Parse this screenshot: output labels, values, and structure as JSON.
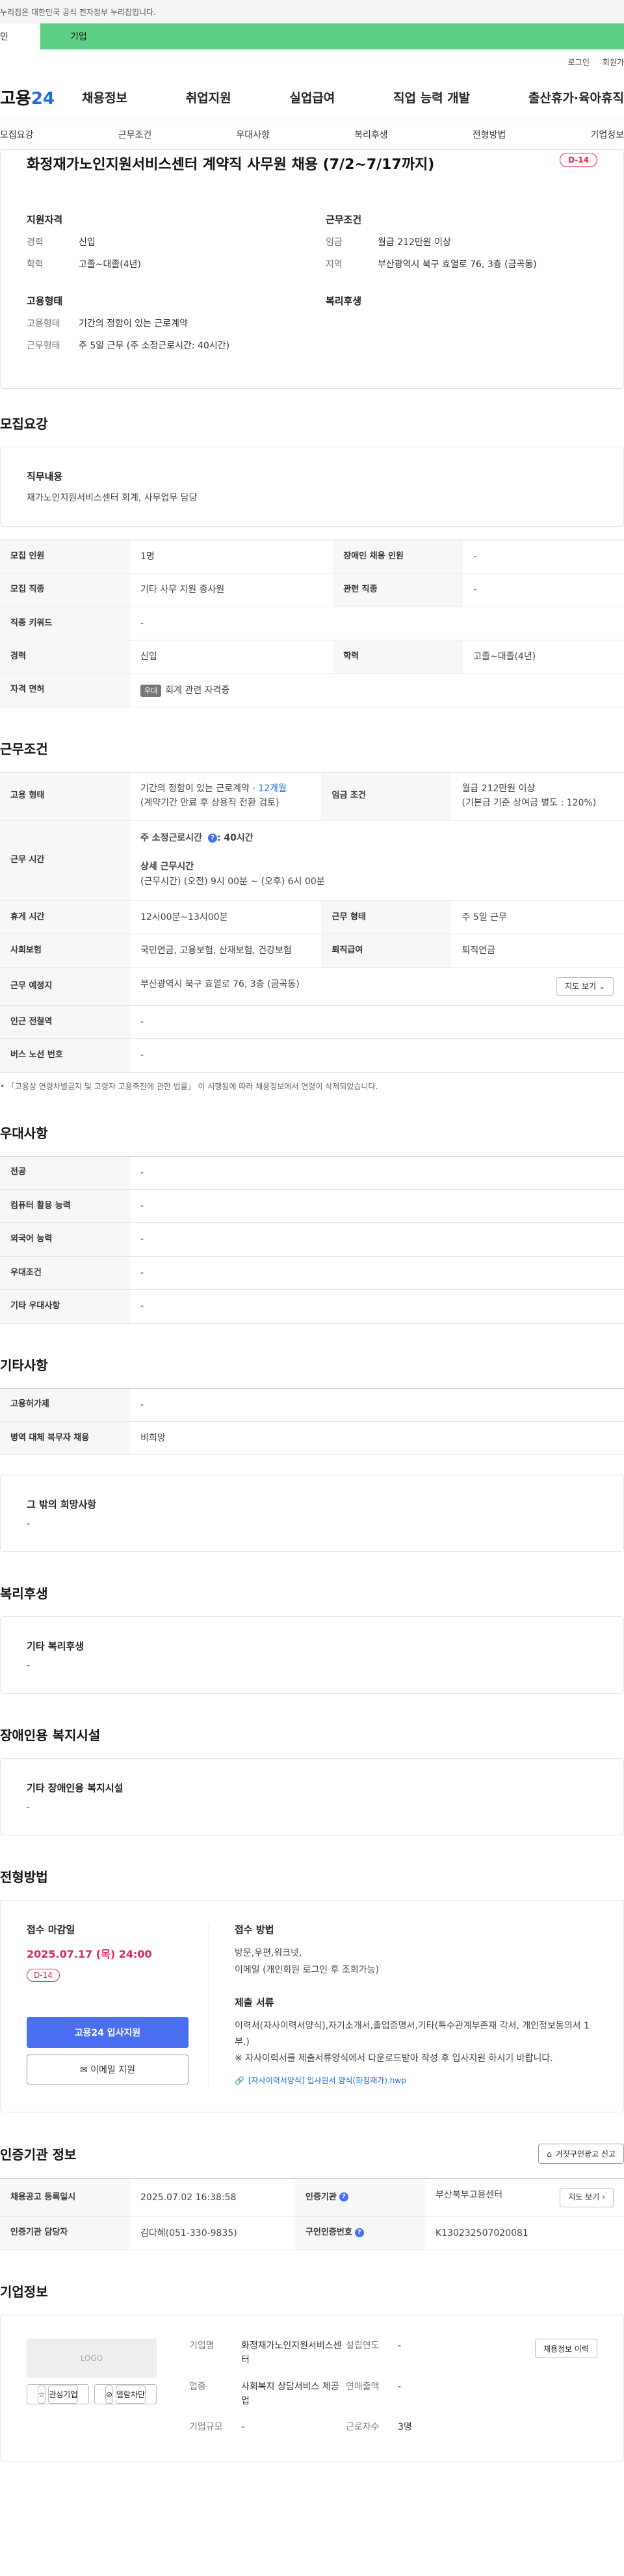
{
  "gov_strip": "누리집은 대한민국 공식 전자정부 누리집입니다.",
  "tabs": [
    "인",
    "기업"
  ],
  "util": [
    "로그인",
    "회원가"
  ],
  "logo": {
    "text": "고용",
    "num": "24"
  },
  "gnb": [
    "채용정보",
    "취업지원",
    "실업급여",
    "직업 능력 개발",
    "출산휴가·육아휴직"
  ],
  "anchors": [
    "모집요강",
    "근무조건",
    "우대사항",
    "복리후생",
    "전형방법",
    "기업정보"
  ],
  "title": "화정재가노인지원서비스센터 계약직 사무원 채용 (7/2~7/17까지)",
  "dday": "D-14",
  "summary": {
    "qual_title": "지원자격",
    "qual": [
      {
        "k": "경력",
        "v": "신입"
      },
      {
        "k": "학력",
        "v": "고졸~대졸(4년)"
      }
    ],
    "work_title": "근무조건",
    "work": [
      {
        "k": "임금",
        "v": "월급 212만원 이상"
      },
      {
        "k": "지역",
        "v": "부산광역시 북구 효열로 76, 3층 (금곡동)"
      }
    ],
    "emp_title": "고용형태",
    "emp": [
      {
        "k": "고용형태",
        "v": "기간의 정함이 있는 근로계약"
      },
      {
        "k": "근무형태",
        "v": "주 5일 근무 (주 소정근로시간: 40시간)"
      }
    ],
    "welfare_title": "복리후생"
  },
  "recruit": {
    "title": "모집요강",
    "duty_title": "직무내용",
    "duty": "재가노인지원서비스센터 회계, 사무업무 담당",
    "rows": [
      [
        {
          "k": "모집 인원",
          "v": "1명"
        },
        {
          "k": "장애인 채용 인원",
          "v": "-"
        }
      ],
      [
        {
          "k": "모집 직종",
          "v": "기타 사무 지원 종사원"
        },
        {
          "k": "관련 직종",
          "v": "-"
        }
      ],
      [
        {
          "k": "직종 키워드",
          "v": "-"
        }
      ],
      [
        {
          "k": "경력",
          "v": "신입"
        },
        {
          "k": "학력",
          "v": "고졸~대졸(4년)"
        }
      ]
    ],
    "license_k": "자격 면허",
    "license_tag": "우대",
    "license_v": "회계 관련 자격증"
  },
  "cond": {
    "title": "근무조건",
    "emp_k": "고용 형태",
    "emp_v1": "기간의 정함이 있는 근로계약 · ",
    "emp_v1b": "12개월",
    "emp_v2": "(계약기간 만료 후 상용직 전환 검토)",
    "wage_k": "임금 조건",
    "wage_v1": "월급 212만원 이상",
    "wage_v2": "(기본급 기준 상여금 별도 : 120%)",
    "time_k": "근무 시간",
    "time_v1": "주 소정근로시간",
    "time_v1b": ": 40시간",
    "time_v2": "상세 근무시간",
    "time_v3": "(근무시간) (오전) 9시 00분 ~ (오후) 6시 00분",
    "rows": [
      [
        {
          "k": "휴게 시간",
          "v": "12시00분~13시00분"
        },
        {
          "k": "근무 형태",
          "v": "주 5일 근무"
        }
      ],
      [
        {
          "k": "사회보험",
          "v": "국민연금, 고용보험, 산재보험, 건강보험"
        },
        {
          "k": "퇴직급여",
          "v": "퇴직연금"
        }
      ]
    ],
    "loc_k": "근무 예정지",
    "loc_v": "부산광역시 북구 효열로 76, 3층 (금곡동)",
    "map_btn": "지도 보기",
    "rows2": [
      {
        "k": "인근 전철역",
        "v": "-"
      },
      {
        "k": "버스 노선 번호",
        "v": "-"
      }
    ],
    "note": "「고용상 연령차별금지 및 고령자 고용촉진에 관한 법률」 이 시행됨에 따라 채용정보에서 연령이 삭제되었습니다."
  },
  "pref": {
    "title": "우대사항",
    "rows": [
      {
        "k": "전공",
        "v": "-"
      },
      {
        "k": "컴퓨터 활용 능력",
        "v": "-"
      },
      {
        "k": "외국어 능력",
        "v": "-"
      },
      {
        "k": "우대조건",
        "v": "-"
      },
      {
        "k": "기타 우대사항",
        "v": "-"
      }
    ]
  },
  "etc": {
    "title": "기타사항",
    "rows": [
      {
        "k": "고용허가제",
        "v": "-"
      },
      {
        "k": "병역 대체 복무자 채용",
        "v": "비희망"
      }
    ],
    "wish_title": "그 밖의 희망사항",
    "wish_v": "-"
  },
  "welfare": {
    "title": "복리후생",
    "box_title": "기타 복리후생",
    "box_v": "-"
  },
  "disabled": {
    "title": "장애인용 복지시설",
    "box_title": "기타 장애인용 복지시설",
    "box_v": "-"
  },
  "apply": {
    "title": "전형방법",
    "deadline_title": "접수 마감일",
    "deadline": "2025.07.17 (목) 24:00",
    "dday": "D-14",
    "btn_primary": "고용24 입사지원",
    "btn_email": "이메일 지원",
    "method_title": "접수 방법",
    "method": "방문,우편,워크넷,\n이메일 (개인회원 로그인 후 조회가능)",
    "docs_title": "제출 서류",
    "docs": "이력서(자사이력서양식),자기소개서,졸업증명서,기타(특수관계부존재 각서, 개인정보동의서 1부.)",
    "docs_note": "※ 자사이력서를 제출서류양식에서 다운로드받아 작성 후 입사지원 하시기 바랍니다.",
    "attach": "[자사이력서양식] 입사원서 양식(화정재가).hwp"
  },
  "cert": {
    "title": "인증기관 정보",
    "report": "거짓구인광고 신고",
    "rows": [
      [
        {
          "k": "채용공고 등록일시",
          "v": "2025.07.02 16:38:58"
        },
        {
          "k": "인증기관",
          "v": "부산북부고용센터"
        }
      ],
      [
        {
          "k": "인증기관 담당자",
          "v": "김다혜(051-330-9835)"
        },
        {
          "k": "구인인증번호",
          "v": "K130232507020081"
        }
      ]
    ],
    "map_btn": "지도 보기"
  },
  "company": {
    "title": "기업정보",
    "logo_ph": "LOGO",
    "btn_fav": "관심기업",
    "btn_block": "열람차단",
    "fields": [
      {
        "k": "기업명",
        "v": "화정재가노인지원서비스센터"
      },
      {
        "k": "설립연도",
        "v": "-"
      },
      {
        "k": "업종",
        "v": "사회복지 상담서비스 제공업"
      },
      {
        "k": "연매출액",
        "v": "-"
      },
      {
        "k": "기업규모",
        "v": "-"
      },
      {
        "k": "근로자수",
        "v": "3명"
      }
    ],
    "history_btn": "채용정보 이력"
  }
}
